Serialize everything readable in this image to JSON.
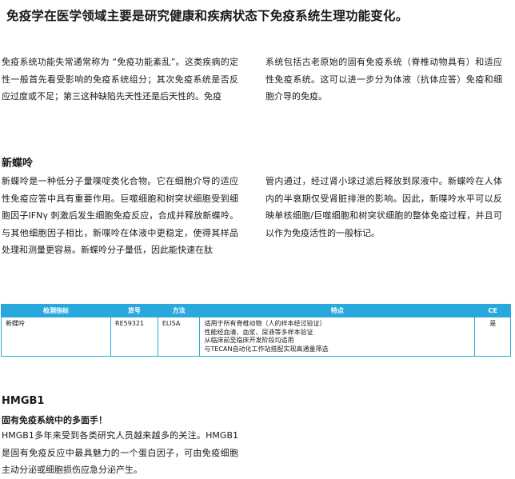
{
  "title": "免疫学在医学领域主要是研究健康和疾病状态下免疫系统生理功能变化。",
  "intro": {
    "left": "免疫系统功能失常通常称为 “免疫功能紊乱”。这类疾病的定性一般首先看受影响的免疫系统组分；其次免疫系统是否反应过度或不足；第三这种缺陷先天性还是后天性的。免疫",
    "right": "系统包括古老原始的固有免疫系统（脊椎动物具有）和适应性免疫系统。这可以进一步分为体液（抗体应答）免疫和细胞介导的免疫。"
  },
  "neopterin": {
    "heading": "新蝶呤",
    "left": "新蝶呤是一种低分子量喋啶类化合物。它在细胞介导的适应性免疫应答中具有重要作用。巨噬细胞和树突状细胞受到细胞因子IFNγ 刺激后发生细胞免疫反应，合成并释放新蝶呤。与其他细胞因子相比，新喋呤在体液中更稳定，使得其样品处理和测量更容易。新蝶呤分子量低，因此能快速在肽",
    "right": "管内通过，经过肾小球过滤后释放到尿液中。新蝶呤在人体内的半衰期仅受肾脏排泄的影响。因此，新喋呤水平可以反映单核细胞/巨噬细胞和树突状细胞的整体免疫过程，并且可以作为免疫活性的一般标记。"
  },
  "table": {
    "headers": [
      "检测指标",
      "货号",
      "方法",
      "特点",
      "CE"
    ],
    "row": {
      "analyte": "新蝶呤",
      "code": "RE59321",
      "method": "ELISA",
      "features": [
        "适用于所有脊椎动物（人的样本经过验证）",
        "性能经血清、血浆、尿液等多样本验证",
        "从临床前至临床开发阶段均适用",
        "与TECAN自动化工作站搭配实现高通量筛选"
      ],
      "ce": "是"
    }
  },
  "hmgb1": {
    "heading": "HMGB1",
    "subheading": "固有免疫系统中的多面手！",
    "text": "HMGB1多年来受到各类研究人员越来越多的关注。HMGB1是固有免疫反应中最具魅力的一个蛋白因子，可由免疫细胞主动分泌或细胞损伤应急分泌产生。"
  },
  "colors": {
    "table_accent": "#29a8de"
  }
}
